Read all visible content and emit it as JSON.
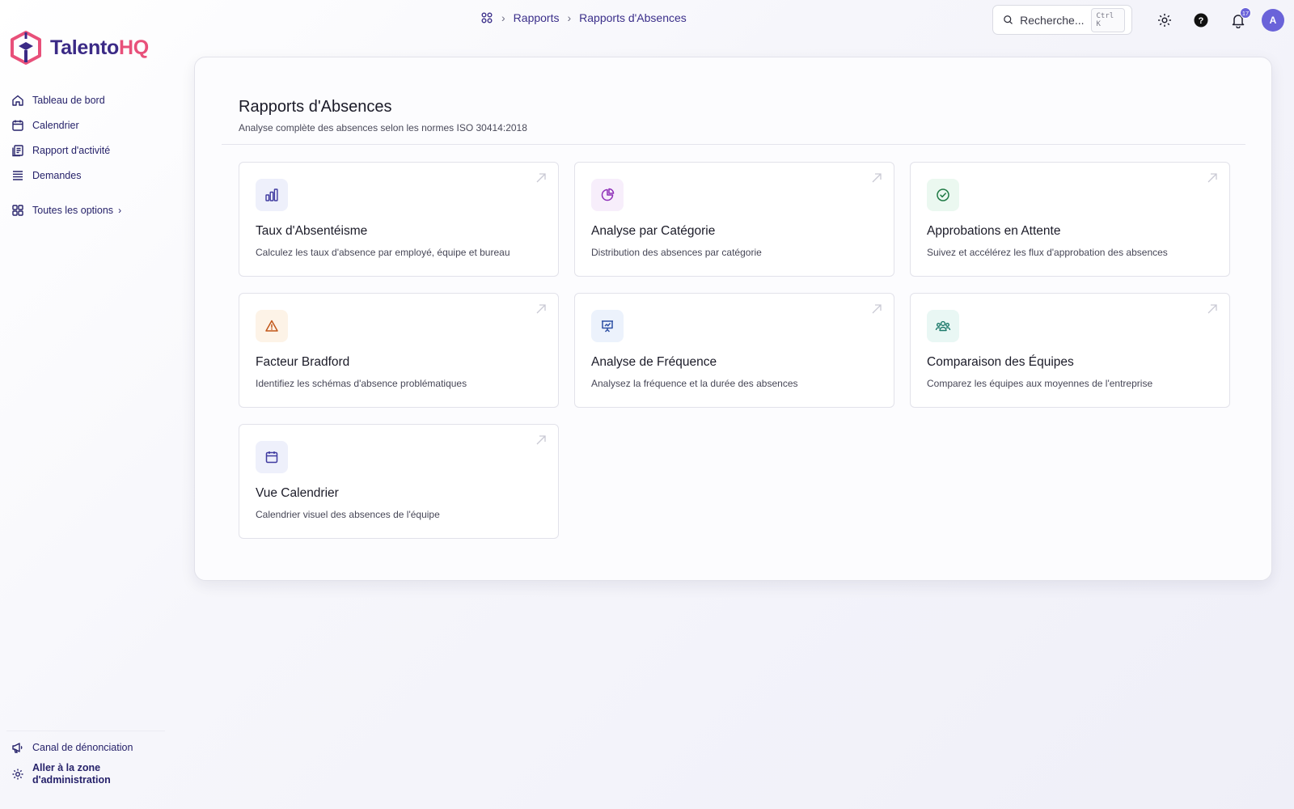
{
  "app": {
    "logo_part1": "Talento",
    "logo_part2": "HQ"
  },
  "colors": {
    "brand": "#3b2a86",
    "accent": "#e8507a",
    "badge": "#6a63d9"
  },
  "sidebar": {
    "items": [
      {
        "label": "Tableau de bord",
        "icon": "home-icon"
      },
      {
        "label": "Calendrier",
        "icon": "calendar-icon"
      },
      {
        "label": "Rapport d'activité",
        "icon": "report-icon"
      },
      {
        "label": "Demandes",
        "icon": "list-icon"
      }
    ],
    "all_options": "Toutes les options",
    "bottom": {
      "whistleblow": "Canal de dénonciation",
      "admin_line1": "Aller à la zone",
      "admin_line2": "d'administration"
    }
  },
  "breadcrumb": {
    "items": [
      "Rapports",
      "Rapports d'Absences"
    ]
  },
  "search": {
    "placeholder": "Recherche...",
    "shortcut": "Ctrl K"
  },
  "notifications": {
    "count": "17"
  },
  "user": {
    "initial": "A"
  },
  "main": {
    "title": "Rapports d'Absences",
    "subtitle": "Analyse complète des absences selon les normes ISO 30414:2018",
    "cards": [
      {
        "title": "Taux d'Absentéisme",
        "desc": "Calculez les taux d'absence par employé, équipe et bureau",
        "icon": "bar-chart-icon",
        "bg": "#eef0fb",
        "fg": "#3f3aa0"
      },
      {
        "title": "Analyse par Catégorie",
        "desc": "Distribution des absences par catégorie",
        "icon": "pie-chart-icon",
        "bg": "#f7eefb",
        "fg": "#8e2fb8"
      },
      {
        "title": "Approbations en Attente",
        "desc": "Suivez et accélérez les flux d'approbation des absences",
        "icon": "check-circle-icon",
        "bg": "#ebf8f0",
        "fg": "#1f7a45"
      },
      {
        "title": "Facteur Bradford",
        "desc": "Identifiez les schémas d'absence problématiques",
        "icon": "warning-icon",
        "bg": "#fdf3e7",
        "fg": "#c2571a"
      },
      {
        "title": "Analyse de Fréquence",
        "desc": "Analysez la fréquence et la durée des absences",
        "icon": "presentation-chart-icon",
        "bg": "#ecf2fc",
        "fg": "#2d4fa3"
      },
      {
        "title": "Comparaison des Équipes",
        "desc": "Comparez les équipes aux moyennes de l'entreprise",
        "icon": "team-icon",
        "bg": "#e9f7f4",
        "fg": "#1d7a6b"
      },
      {
        "title": "Vue Calendrier",
        "desc": "Calendrier visuel des absences de l'équipe",
        "icon": "calendar-icon",
        "bg": "#eef0fb",
        "fg": "#3f3aa0"
      }
    ]
  }
}
